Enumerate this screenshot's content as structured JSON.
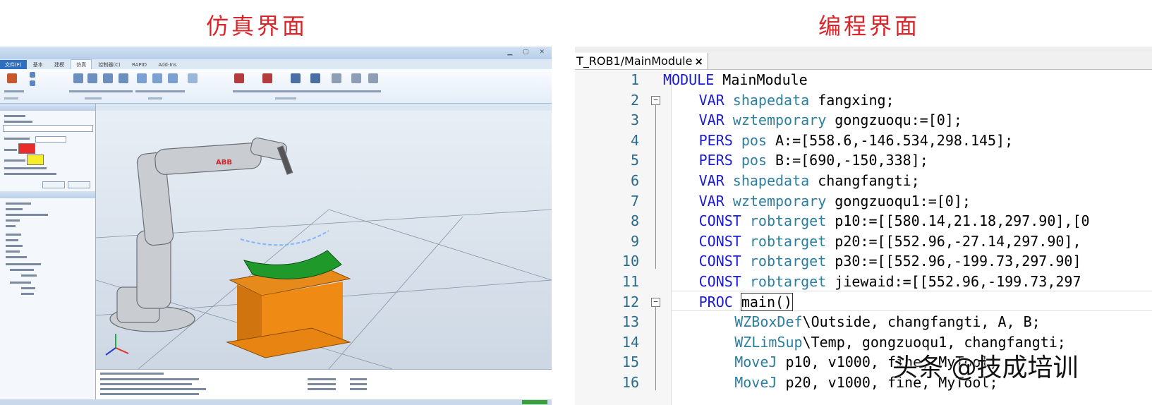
{
  "headings": {
    "simulation": "仿真界面",
    "programming": "编程界面"
  },
  "simulation": {
    "accent": "#1f5fa8",
    "tool_label": "ABB",
    "ribbon_tabs": [
      "文件(F)",
      "基本",
      "建模",
      "仿真",
      "控制器(C)",
      "RAPID",
      "Add-Ins"
    ],
    "icons": [
      "robot-arm-icon",
      "workpiece-icon",
      "worktable-icon",
      "coordinate-axes-icon"
    ]
  },
  "editor": {
    "tab_label": "T_ROB1/MainModule",
    "close_glyph": "×",
    "lines": [
      {
        "n": "1",
        "kw": "MODULE",
        "ty": "",
        "rest": " MainModule",
        "indent": 0
      },
      {
        "n": "2",
        "kw": "VAR",
        "ty": "shapedata",
        "rest": " fangxing;",
        "indent": 1
      },
      {
        "n": "3",
        "kw": "VAR",
        "ty": "wztemporary",
        "rest": " gongzuoqu:=[0];",
        "indent": 1
      },
      {
        "n": "4",
        "kw": "PERS",
        "ty": "pos",
        "rest": " A:=[558.6,-146.534,298.145];",
        "indent": 1
      },
      {
        "n": "5",
        "kw": "PERS",
        "ty": "pos",
        "rest": " B:=[690,-150,338];",
        "indent": 1
      },
      {
        "n": "6",
        "kw": "VAR",
        "ty": "shapedata",
        "rest": " changfangti;",
        "indent": 1
      },
      {
        "n": "7",
        "kw": "VAR",
        "ty": "wztemporary",
        "rest": " gongzuoqu1:=[0];",
        "indent": 1
      },
      {
        "n": "8",
        "kw": "CONST",
        "ty": "robtarget",
        "rest": " p10:=[[580.14,21.18,297.90],[0",
        "indent": 1
      },
      {
        "n": "9",
        "kw": "CONST",
        "ty": "robtarget",
        "rest": " p20:=[[552.96,-27.14,297.90],",
        "indent": 1
      },
      {
        "n": "10",
        "kw": "CONST",
        "ty": "robtarget",
        "rest": " p30:=[[552.96,-199.73,297.90]",
        "indent": 1
      },
      {
        "n": "11",
        "kw": "CONST",
        "ty": "robtarget",
        "rest": " jiewaid:=[[552.96,-199.73,297",
        "indent": 1
      },
      {
        "n": "12",
        "kw": "PROC",
        "ty": "",
        "rest": "main()",
        "indent": 1
      },
      {
        "n": "13",
        "kw": "",
        "ty": "WZBoxDef",
        "rest": "\\Outside, changfangti, A, B;",
        "indent": 2
      },
      {
        "n": "14",
        "kw": "",
        "ty": "WZLimSup",
        "rest": "\\Temp, gongzuoqu1, changfangti;",
        "indent": 2
      },
      {
        "n": "15",
        "kw": "",
        "ty": "MoveJ",
        "rest": " p10, v1000, fine, MyTool;",
        "indent": 2
      },
      {
        "n": "16",
        "kw": "",
        "ty": "MoveJ",
        "rest": " p20, v1000, fine, MyTool;",
        "indent": 2
      }
    ]
  },
  "watermark": "头条 @技成培训",
  "icons": [
    "close-icon",
    "fold-minus-icon"
  ]
}
